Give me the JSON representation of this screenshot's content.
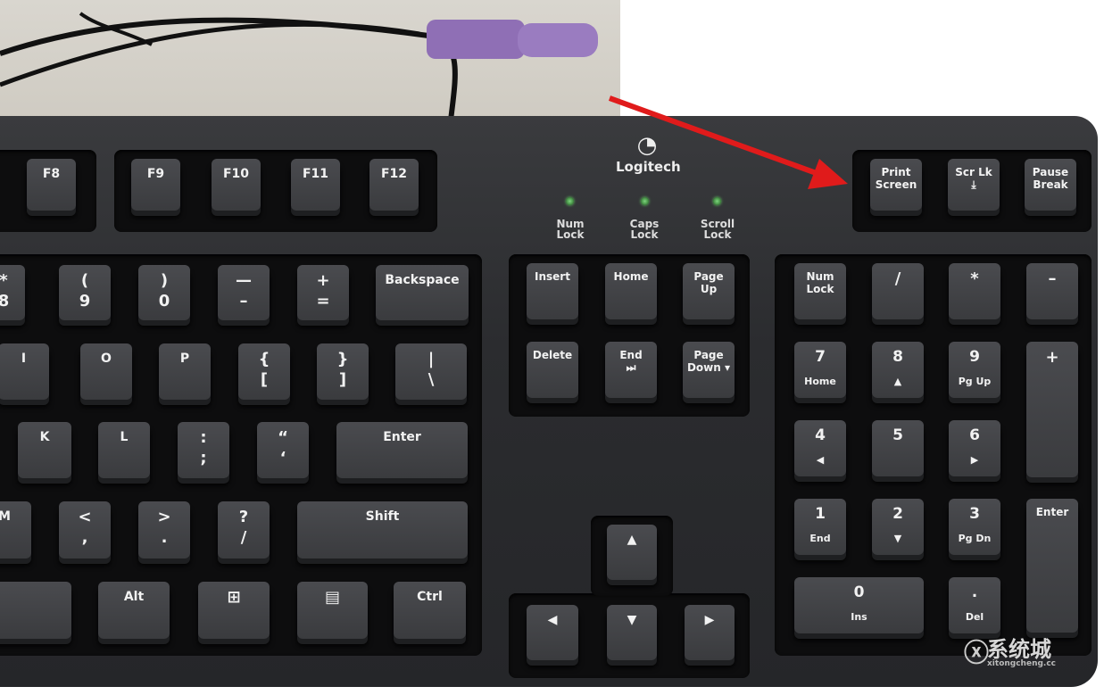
{
  "brand": {
    "logo_text": "Logitech"
  },
  "indicators": [
    {
      "label": "Num Lock",
      "color": "#4caf50"
    },
    {
      "label": "Caps Lock",
      "color": "#4caf50"
    },
    {
      "label": "Scroll Lock",
      "color": "#4caf50"
    }
  ],
  "annotation": {
    "arrow_color": "#e01b1b",
    "target": "Print Screen"
  },
  "watermark": {
    "cn": "系统城",
    "en": "xitongcheng.cc"
  },
  "keys": {
    "f8": {
      "l1": "F8"
    },
    "f9": {
      "l1": "F9"
    },
    "f10": {
      "l1": "F10"
    },
    "f11": {
      "l1": "F11"
    },
    "f12": {
      "l1": "F12"
    },
    "prtsc": {
      "l1": "Print",
      "l2": "Screen"
    },
    "scrlk": {
      "l1": "Scr Lk",
      "l2": "⤓"
    },
    "pause": {
      "l1": "Pause",
      "l2": "Break"
    },
    "k8": {
      "l1": "*",
      "l2": "8"
    },
    "k9": {
      "l1": "(",
      "l2": "9"
    },
    "k0": {
      "l1": ")",
      "l2": "0"
    },
    "minus": {
      "l1": "—",
      "l2": "–"
    },
    "equal": {
      "l1": "+",
      "l2": "="
    },
    "backspace": {
      "l1": "Backspace"
    },
    "i": {
      "l1": "I"
    },
    "o": {
      "l1": "O"
    },
    "p": {
      "l1": "P"
    },
    "lbracket": {
      "l1": "{",
      "l2": "["
    },
    "rbracket": {
      "l1": "}",
      "l2": "]"
    },
    "backslash": {
      "l1": "|",
      "l2": "\\"
    },
    "k": {
      "l1": "K"
    },
    "l": {
      "l1": "L"
    },
    "semicolon": {
      "l1": ":",
      "l2": ";"
    },
    "quote": {
      "l1": "“",
      "l2": "‘"
    },
    "enter": {
      "l1": "Enter"
    },
    "m": {
      "l1": "M"
    },
    "comma": {
      "l1": "<",
      "l2": ","
    },
    "period": {
      "l1": ">",
      "l2": "."
    },
    "slash": {
      "l1": "?",
      "l2": "/"
    },
    "shift": {
      "l1": "Shift"
    },
    "space": {
      "l1": ""
    },
    "alt": {
      "l1": "Alt"
    },
    "win": {
      "l1": "⊞"
    },
    "menu": {
      "l1": "▤"
    },
    "ctrl": {
      "l1": "Ctrl"
    },
    "insert": {
      "l1": "Insert"
    },
    "home": {
      "l1": "Home"
    },
    "pgup": {
      "l1": "Page",
      "l2": "Up"
    },
    "delete": {
      "l1": "Delete"
    },
    "end": {
      "l1": "End",
      "l2": "⏭"
    },
    "pgdn": {
      "l1": "Page",
      "l2": "Down ▾"
    },
    "up": {
      "l1": "▲"
    },
    "left": {
      "l1": "◀"
    },
    "down": {
      "l1": "▼"
    },
    "right": {
      "l1": "▶"
    },
    "numlock": {
      "l1": "Num",
      "l2": "Lock"
    },
    "ndiv": {
      "l1": "/"
    },
    "nmul": {
      "l1": "*"
    },
    "nsub": {
      "l1": "–"
    },
    "n7": {
      "l1": "7",
      "l2": "Home"
    },
    "n8": {
      "l1": "8",
      "l2": "▲"
    },
    "n9": {
      "l1": "9",
      "l2": "Pg Up"
    },
    "nadd": {
      "l1": "+"
    },
    "n4": {
      "l1": "4",
      "l2": "◀"
    },
    "n5": {
      "l1": "5"
    },
    "n6": {
      "l1": "6",
      "l2": "▶"
    },
    "n1": {
      "l1": "1",
      "l2": "End"
    },
    "n2": {
      "l1": "2",
      "l2": "▼"
    },
    "n3": {
      "l1": "3",
      "l2": "Pg Dn"
    },
    "nenter": {
      "l1": "Enter"
    },
    "n0": {
      "l1": "0",
      "l2": "Ins"
    },
    "ndot": {
      "l1": ".",
      "l2": "Del"
    }
  }
}
